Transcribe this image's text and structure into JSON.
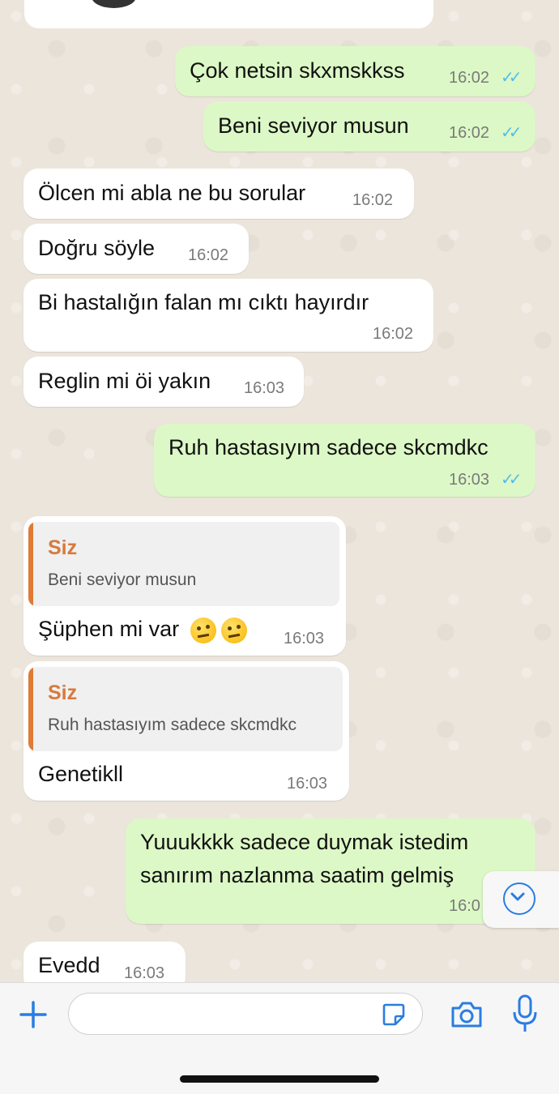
{
  "messages": [
    {
      "text": "Çok netsin skxmskkss",
      "time": "16:02",
      "dir": "out"
    },
    {
      "text": "Beni seviyor musun",
      "time": "16:02",
      "dir": "out"
    },
    {
      "text": "Ölcen mi abla ne bu sorular",
      "time": "16:02",
      "dir": "in"
    },
    {
      "text": "Doğru söyle",
      "time": "16:02",
      "dir": "in"
    },
    {
      "text": "Bi hastalığın falan mı cıktı hayırdır",
      "time": "16:02",
      "dir": "in"
    },
    {
      "text": "Reglin mi öi yakın",
      "time": "16:03",
      "dir": "in"
    },
    {
      "text": "Ruh hastasıyım sadece skcmdkc",
      "time": "16:03",
      "dir": "out"
    },
    {
      "quote_author": "Siz",
      "quote_text": "Beni seviyor musun",
      "text": "Şüphen mi var",
      "time": "16:03",
      "dir": "in"
    },
    {
      "quote_author": "Siz",
      "quote_text": "Ruh hastasıyım sadece skcmdkc",
      "text": "Genetikll",
      "time": "16:03",
      "dir": "in"
    },
    {
      "text_line1": "Yuuukkkk sadece duymak istedim",
      "text_line2": "sanırım nazlanma saatim gelmiş",
      "time": "16:0",
      "dir": "out"
    },
    {
      "text": "Evedd",
      "time": "16:03",
      "dir": "in"
    }
  ],
  "read_ticks": "✓✓",
  "composer": {
    "placeholder": ""
  },
  "colors": {
    "outgoing": "#dcf8c6",
    "incoming": "#ffffff",
    "accent": "#2a7de1",
    "quote_author": "#d77a3c",
    "ticks": "#53bdeb"
  },
  "icons": {
    "emoji_0": "raised-eyebrow-emoji",
    "emoji_1": "raised-eyebrow-emoji"
  }
}
